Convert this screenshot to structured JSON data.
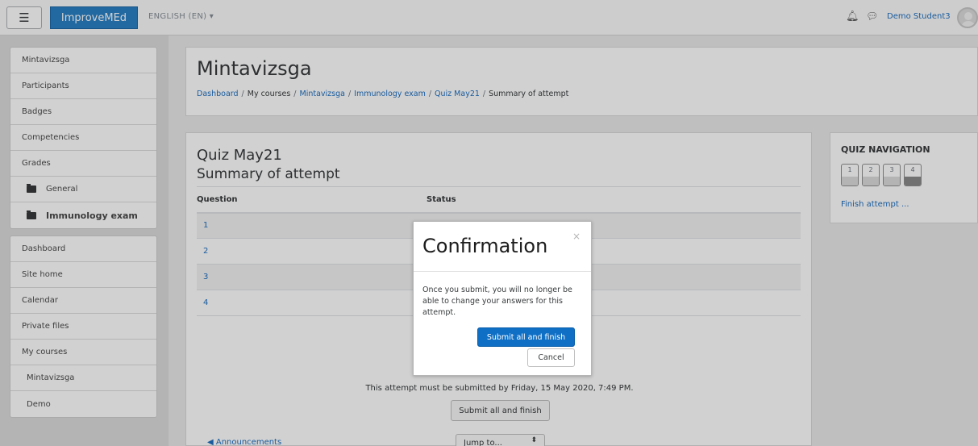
{
  "navbar": {
    "brand": "ImproveMEd",
    "language": "ENGLISH (EN) ▾",
    "username": "Demo Student3",
    "icons": [
      "menu-icon",
      "bell-icon",
      "chat-icon",
      "avatar"
    ]
  },
  "sidebar": {
    "course_block": [
      {
        "label": "Mintavizsga"
      },
      {
        "label": "Participants"
      },
      {
        "label": "Badges"
      },
      {
        "label": "Competencies"
      },
      {
        "label": "Grades"
      },
      {
        "label": "General"
      },
      {
        "label": "Immunology exam"
      }
    ],
    "site_block": [
      {
        "label": "Dashboard"
      },
      {
        "label": "Site home"
      },
      {
        "label": "Calendar"
      },
      {
        "label": "Private files"
      },
      {
        "label": "My courses"
      },
      {
        "label": "Mintavizsga"
      },
      {
        "label": "Demo"
      }
    ]
  },
  "header": {
    "title": "Mintavizsga",
    "breadcrumb": [
      "Dashboard",
      "My courses",
      "Mintavizsga",
      "Immunology exam",
      "Quiz May21",
      "Summary of attempt"
    ],
    "separator": "/"
  },
  "main": {
    "quiz_title": "Quiz May21",
    "summary_title": "Summary of attempt",
    "table_headers": [
      "Question",
      "Status"
    ],
    "questions": [
      "1",
      "2",
      "3",
      "4"
    ],
    "deadline_text": "This attempt must be submitted by Friday, 15 May 2020, 7:49 PM.",
    "submit_button": "Submit all and finish",
    "prev_link": "◀ Announcements",
    "jump_select": "Jump to...",
    "jump_caret": "⬍"
  },
  "quiz_nav": {
    "title": "QUIZ NAVIGATION",
    "buttons": [
      "1",
      "2",
      "3",
      "4"
    ],
    "finish_link": "Finish attempt ..."
  },
  "modal": {
    "title": "Confirmation",
    "close": "×",
    "body": "Once you submit, you will no longer be able to change your answers for this attempt.",
    "submit": "Submit all and finish",
    "cancel": "Cancel"
  }
}
